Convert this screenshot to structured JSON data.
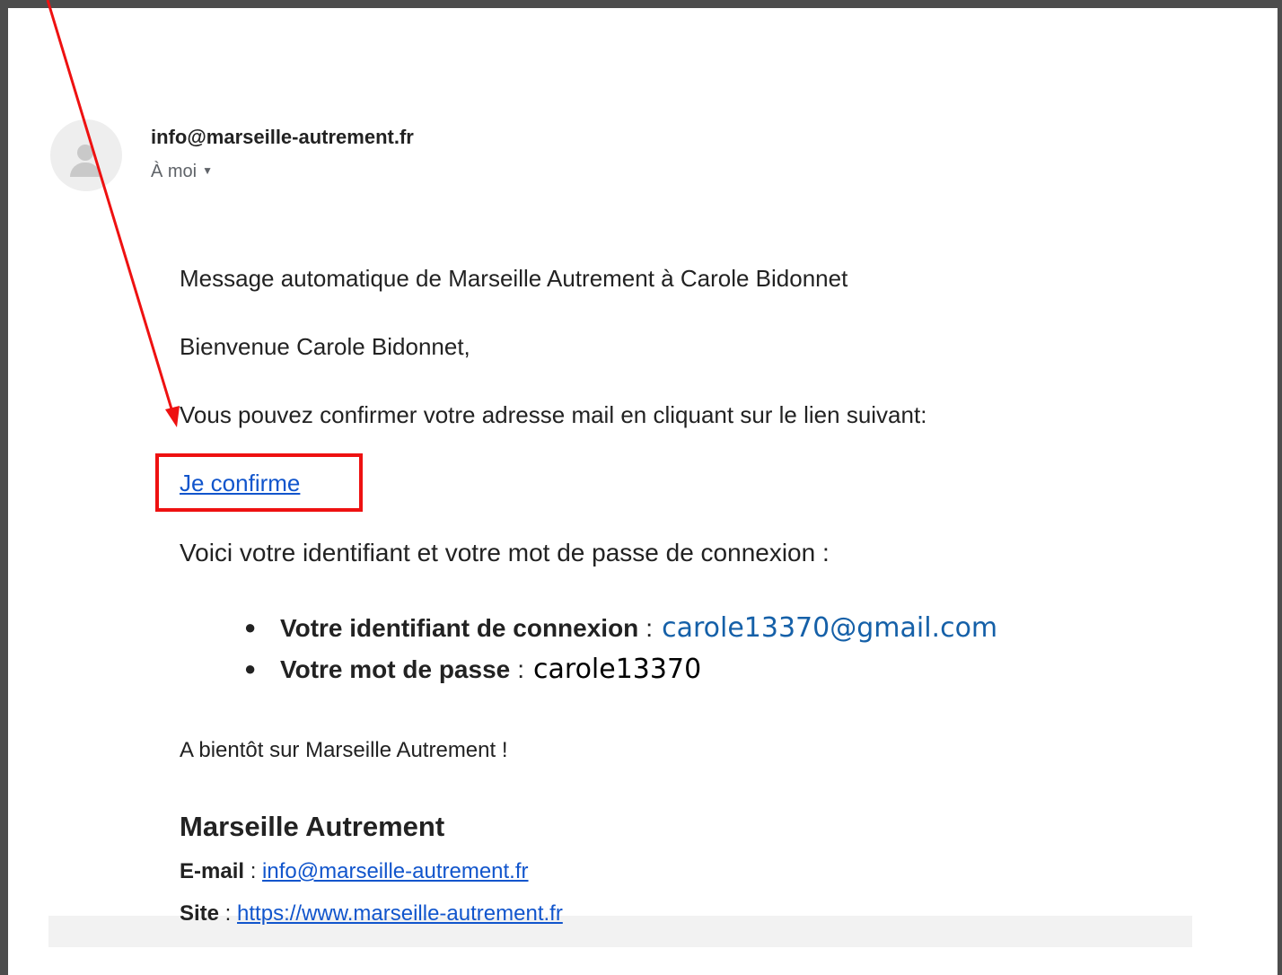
{
  "email": {
    "sender": "info@marseille-autrement.fr",
    "recipient_label": "À moi",
    "body": {
      "intro": "Message automatique de Marseille Autrement à Carole Bidonnet",
      "greeting": "Bienvenue Carole Bidonnet,",
      "confirm_prompt": "Vous pouvez confirmer votre adresse mail en cliquant sur le lien suivant:",
      "confirm_link": "Je confirme",
      "credentials_intro": "Voici votre identifiant et votre mot de passe de connexion :",
      "credentials": [
        {
          "label": "Votre identifiant de connexion",
          "value": "carole13370@gmail.com"
        },
        {
          "label": "Votre mot de passe",
          "value": "carole13370"
        }
      ],
      "closing": "A bientôt sur Marseille Autrement !"
    },
    "signature": {
      "name": "Marseille Autrement",
      "email_label": "E-mail",
      "email_value": "info@marseille-autrement.fr",
      "site_label": "Site",
      "site_value": "https://www.marseille-autrement.fr"
    }
  },
  "annotation": {
    "color": "#ee1111"
  },
  "colors": {
    "link": "#1155cc",
    "frame": "#4d4d4d",
    "annotation": "#ee1111"
  }
}
